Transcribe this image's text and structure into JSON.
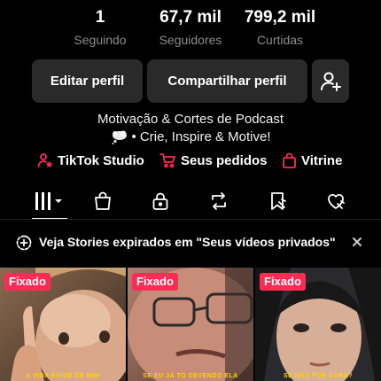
{
  "stats": [
    {
      "value": "1",
      "label": "Seguindo"
    },
    {
      "value": "67,7 mil",
      "label": "Seguidores"
    },
    {
      "value": "799,2 mil",
      "label": "Curtidas"
    }
  ],
  "buttons": {
    "edit_label": "Editar perfil",
    "share_label": "Compartilhar perfil",
    "add_friend_icon": "person-add-icon"
  },
  "bio": {
    "line1": "Motivação & Cortes de Podcast",
    "line2": "• Crie, Inspire & Motive!",
    "emoji_icon": "thought-bubble-icon"
  },
  "links": [
    {
      "label": "TikTok Studio",
      "icon": "person-star-icon"
    },
    {
      "label": "Seus pedidos",
      "icon": "cart-icon"
    },
    {
      "label": "Vitrine",
      "icon": "shopping-bag-icon"
    }
  ],
  "tabs": [
    {
      "icon": "grid-icon",
      "active": true
    },
    {
      "icon": "bag-icon"
    },
    {
      "icon": "lock-icon"
    },
    {
      "icon": "repost-icon"
    },
    {
      "icon": "bookmark-icon"
    },
    {
      "icon": "liked-icon"
    }
  ],
  "banner": {
    "text": "Veja Stories expirados em \"Seus vídeos privados\""
  },
  "videos": [
    {
      "badge": "Fixado",
      "caption": "A VIDA EXIGE DE MIM"
    },
    {
      "badge": "Fixado",
      "caption": "SE EU JÁ TO DEVENDO ELA"
    },
    {
      "badge": "Fixado",
      "caption": "SE NÃO FOR CARA?"
    }
  ],
  "colors": {
    "background": "#000000",
    "button_bg": "#2a2a2a",
    "accent": "#fe2c55",
    "muted_text": "#8d8d8d"
  }
}
